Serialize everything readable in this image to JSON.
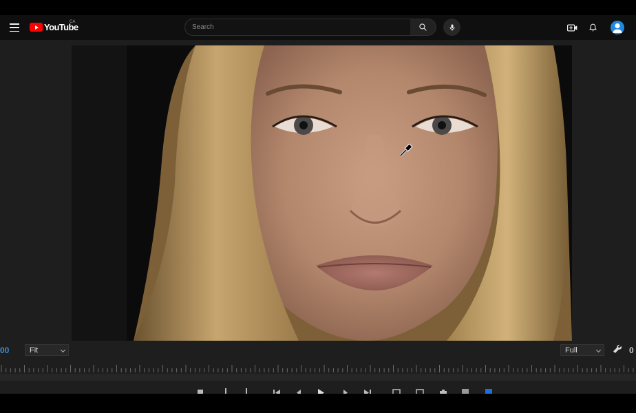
{
  "masthead": {
    "logo_text": "YouTube",
    "country_code": "CA",
    "search_placeholder": "Search"
  },
  "monitor": {
    "timecode_left": "00",
    "zoom_select": "Fit",
    "resolution_select": "Full",
    "timecode_right": "0"
  },
  "icons": [
    "menu-icon",
    "youtube-logo-icon",
    "search-icon",
    "microphone-icon",
    "create-video-icon",
    "notifications-icon",
    "account-icon",
    "wrench-icon",
    "eyedropper-cursor-icon"
  ],
  "colors": {
    "youtube_red": "#ff0000",
    "masthead_bg": "#0f0f0f",
    "panel_bg": "#1e1e1e",
    "timecode_blue": "#3b8fe0",
    "avatar_blue": "#1e88e5"
  }
}
